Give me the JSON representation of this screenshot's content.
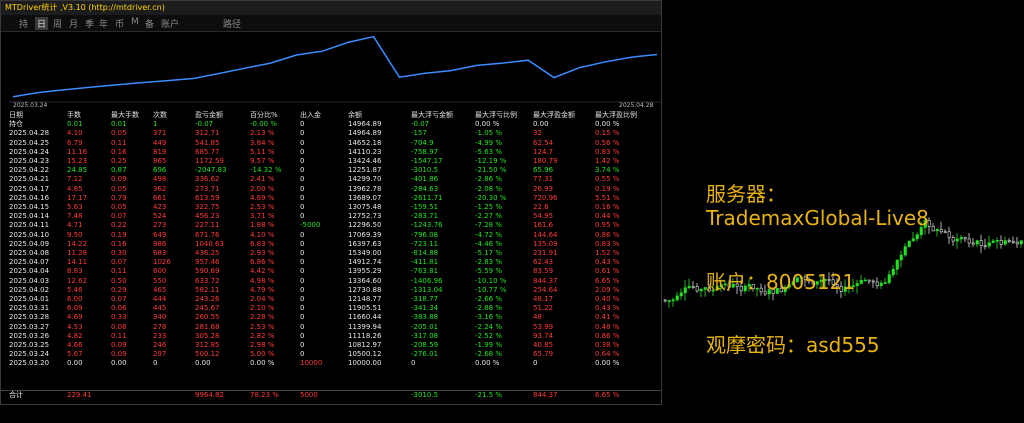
{
  "window": {
    "title": "MTDriver统计 ,V3.10 (http://mtdriver.cn)"
  },
  "menu": [
    {
      "label": "持",
      "active": false
    },
    {
      "label": "日",
      "active": true
    },
    {
      "label": "周",
      "active": false
    },
    {
      "label": "月",
      "active": false
    },
    {
      "label": "季",
      "active": false
    },
    {
      "label": "年",
      "active": false
    },
    {
      "label": "币",
      "active": false
    },
    {
      "label": "M",
      "active": false
    },
    {
      "label": "备",
      "active": false
    },
    {
      "label": "账户",
      "active": false
    },
    {
      "label": "路径",
      "active": false
    }
  ],
  "equity": {
    "start_label": "2025.03.24",
    "end_label": "2025.04.28",
    "values": [
      10000,
      10500,
      10813,
      11119,
      11400,
      11660,
      11905,
      12149,
      12731,
      13364,
      13955,
      14913,
      15349,
      16398,
      17069,
      12296,
      12753,
      13075,
      13690,
      13963,
      14300,
      12252,
      13424,
      14110,
      14652,
      14965
    ]
  },
  "table": {
    "headers": [
      "日期",
      "手数",
      "最大手数",
      "次数",
      "盈亏金额",
      "百分比%",
      "出入金",
      "余额",
      "最大浮亏金额",
      "最大浮亏比例",
      "最大浮盈金额",
      "最大浮盈比例"
    ],
    "position_row": {
      "date": "持仓",
      "lots": "0.01",
      "maxlots": "0.01",
      "count": "1",
      "pnl": "-0.07",
      "pct": "-0.00 %",
      "io": "0",
      "bal": "14964.89",
      "fl": "-0.07",
      "flp": "0.00 %",
      "fp": "0.00",
      "fpp": "0.00 %"
    },
    "rows": [
      [
        "2025.04.28",
        "4.10",
        "0.05",
        "371",
        "312.71",
        "2.13 %",
        "0",
        "14964.89",
        "-157",
        "-1.05 %",
        "32",
        "0.15 %",
        "p"
      ],
      [
        "2025.04.25",
        "6.79",
        "0.11",
        "449",
        "541.85",
        "3.84 %",
        "0",
        "14652.18",
        "-704.9",
        "-4.99 %",
        "62.54",
        "0.56 %",
        "p"
      ],
      [
        "2025.04.24",
        "11.16",
        "0.16",
        "819",
        "685.77",
        "5.11 %",
        "0",
        "14110.23",
        "-758.97",
        "-5.63 %",
        "124.7",
        "0.83 %",
        "p"
      ],
      [
        "2025.04.23",
        "15.23",
        "0.25",
        "865",
        "1172.59",
        "9.57 %",
        "0",
        "13424.46",
        "-1547.17",
        "-12.19 %",
        "180.79",
        "1.42 %",
        "p"
      ],
      [
        "2025.04.22",
        "24.85",
        "0.87",
        "696",
        "-2047.83",
        "-14.32 %",
        "0",
        "12251.87",
        "-3010.5",
        "-21.50 %",
        "65.96",
        "3.74 %",
        "n"
      ],
      [
        "2025.04.21",
        "7.12",
        "0.09",
        "498",
        "336.62",
        "2.41 %",
        "0",
        "14299.70",
        "-401.86",
        "-2.86 %",
        "77.31",
        "0.55 %",
        "p"
      ],
      [
        "2025.04.17",
        "4.85",
        "0.05",
        "362",
        "273.71",
        "2.00 %",
        "0",
        "13962.78",
        "-284.63",
        "-2.08 %",
        "26.93",
        "0.19 %",
        "p"
      ],
      [
        "2025.04.16",
        "17.17",
        "0.79",
        "661",
        "613.59",
        "4.69 %",
        "0",
        "13689.07",
        "-2611.71",
        "-20.30 %",
        "720.96",
        "5.51 %",
        "p"
      ],
      [
        "2025.04.15",
        "5.63",
        "0.05",
        "423",
        "322.75",
        "2.53 %",
        "0",
        "13075.48",
        "-159.51",
        "-1.25 %",
        "22.6",
        "0.16 %",
        "p"
      ],
      [
        "2025.04.14",
        "7.48",
        "0.07",
        "524",
        "456.23",
        "3.71 %",
        "0",
        "12752.73",
        "-283.71",
        "-2.27 %",
        "54.95",
        "0.44 %",
        "p"
      ],
      [
        "2025.04.11",
        "4.71",
        "0.22",
        "273",
        "227.11",
        "1.88 %",
        "-5000",
        "12296.50",
        "-1243.76",
        "-7.28 %",
        "161.6",
        "0.95 %",
        "p"
      ],
      [
        "2025.04.10",
        "9.50",
        "0.19",
        "649",
        "671.76",
        "4.10 %",
        "0",
        "17069.39",
        "-796.08",
        "-4.72 %",
        "144.64",
        "0.86 %",
        "p"
      ],
      [
        "2025.04.09",
        "14.22",
        "0.16",
        "886",
        "1040.63",
        "6.83 %",
        "0",
        "16397.63",
        "-723.11",
        "-4.46 %",
        "135.09",
        "0.83 %",
        "p"
      ],
      [
        "2025.04.08",
        "11.28",
        "0.30",
        "683",
        "436.25",
        "2.93 %",
        "0",
        "15349.00",
        "-814.88",
        "-5.17 %",
        "231.91",
        "1.52 %",
        "p"
      ],
      [
        "2025.04.07",
        "14.11",
        "0.07",
        "1026",
        "957.46",
        "6.86 %",
        "0",
        "14912.74",
        "-411.81",
        "-2.83 %",
        "62.43",
        "0.43 %",
        "p"
      ],
      [
        "2025.04.04",
        "8.83",
        "0.11",
        "600",
        "590.69",
        "4.42 %",
        "0",
        "13955.29",
        "-763.81",
        "-5.59 %",
        "83.59",
        "0.61 %",
        "p"
      ],
      [
        "2025.04.03",
        "12.62",
        "0.50",
        "550",
        "633.72",
        "4.98 %",
        "0",
        "13364.60",
        "-1406.96",
        "-10.10 %",
        "844.37",
        "6.65 %",
        "p"
      ],
      [
        "2025.04.02",
        "5.46",
        "0.29",
        "465",
        "582.11",
        "4.79 %",
        "0",
        "12730.88",
        "-1313.04",
        "-10.77 %",
        "254.64",
        "2.09 %",
        "p"
      ],
      [
        "2025.04.01",
        "6.00",
        "0.07",
        "444",
        "243.26",
        "2.04 %",
        "0",
        "12148.77",
        "-318.77",
        "-2.66 %",
        "48.17",
        "0.40 %",
        "p"
      ],
      [
        "2025.03.31",
        "6.09",
        "0.06",
        "445",
        "245.67",
        "2.10 %",
        "0",
        "11905.51",
        "-341.34",
        "-2.88 %",
        "51.22",
        "0.43 %",
        "p"
      ],
      [
        "2025.03.28",
        "4.69",
        "0.33",
        "340",
        "260.55",
        "2.28 %",
        "0",
        "11660.44",
        "-383.88",
        "-3.16 %",
        "48",
        "0.41 %",
        "p"
      ],
      [
        "2025.03.27",
        "4.53",
        "0.08",
        "278",
        "281.68",
        "2.53 %",
        "0",
        "11399.94",
        "-205.01",
        "-2.24 %",
        "53.99",
        "0.48 %",
        "p"
      ],
      [
        "2025.03.26",
        "4.82",
        "0.11",
        "233",
        "305.28",
        "2.82 %",
        "0",
        "11118.26",
        "-317.08",
        "-2.52 %",
        "93.74",
        "0.86 %",
        "p"
      ],
      [
        "2025.03.25",
        "4.66",
        "0.09",
        "246",
        "312.85",
        "2.98 %",
        "0",
        "10812.97",
        "-208.59",
        "-1.99 %",
        "40.85",
        "0.38 %",
        "p"
      ],
      [
        "2025.03.24",
        "5.67",
        "0.09",
        "297",
        "500.12",
        "5.00 %",
        "0",
        "10500.12",
        "-276.01",
        "-2.68 %",
        "65.79",
        "0.64 %",
        "p"
      ],
      [
        "2025.03.20",
        "0.00",
        "0.00",
        "0",
        "0.00",
        "0.00 %",
        "10000",
        "10000.00",
        "0",
        "0.00 %",
        "0",
        "0.00 %",
        "w"
      ]
    ],
    "total": {
      "date": "合计",
      "lots": "229.41",
      "pnl": "9964.82",
      "pct": "78.23 %",
      "io": "5000",
      "fl": "-3010.5",
      "flp": "-21.5 %",
      "fp": "844.37",
      "fpp": "6.65 %"
    }
  },
  "overlay": {
    "server_label": "服务器：",
    "server_value": "TrademaxGlobal-Live8",
    "account": "账户：8005121",
    "password": "观摩密码：asd555"
  },
  "colors": {
    "bull": "#22e022",
    "bear": "#ff3a3a",
    "accent": "#e8b30f",
    "equity": "#3a8cff"
  }
}
